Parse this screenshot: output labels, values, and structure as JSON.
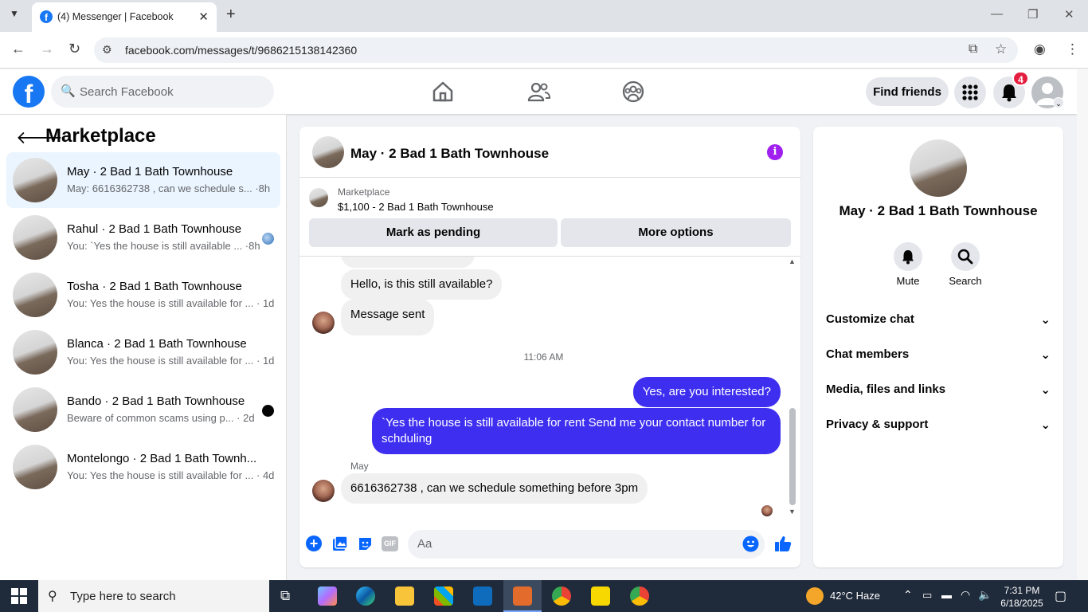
{
  "browser": {
    "tab_title": "(4) Messenger | Facebook",
    "url": "facebook.com/messages/t/9686215138142360"
  },
  "fb_header": {
    "search_placeholder": "Search Facebook",
    "find_friends": "Find friends",
    "notification_count": "4"
  },
  "left_panel": {
    "title": "Marketplace",
    "conversations": [
      {
        "name": "May · 2 Bad 1 Bath Townhouse",
        "preview": "May: 6616362738 , can we schedule s... ·8h",
        "active": true
      },
      {
        "name": "Rahul · 2 Bad 1 Bath Townhouse",
        "preview": "You: `Yes the house is still available ... ·8h"
      },
      {
        "name": "Tosha · 2 Bad 1 Bath Townhouse",
        "preview": "You: Yes the house is still available for ... · 1d"
      },
      {
        "name": "Blanca · 2 Bad 1 Bath Townhouse",
        "preview": "You: Yes the house is still available for ... · 1d"
      },
      {
        "name": "Bando · 2 Bad 1 Bath Townhouse",
        "preview": "Beware of common scams using p... · 2d"
      },
      {
        "name": "Montelongo · 2 Bad 1 Bath Townh...",
        "preview": "You: Yes the house is still available for ... · 4d"
      }
    ]
  },
  "chat": {
    "title": "May · 2 Bad 1 Bath Townhouse",
    "marketplace_label": "Marketplace",
    "listing": "$1,100 - 2 Bad 1 Bath Townhouse",
    "mark_pending": "Mark as pending",
    "more_options": "More options",
    "messages": {
      "m1": "Hello, is this still available?",
      "m2": "Message sent",
      "timestamp": "11:06 AM",
      "m3": "Yes, are you interested?",
      "m4": "`Yes the house is still available for rent Send me your contact number for schduling",
      "sender": "May",
      "m5": "6616362738 , can we schedule something before 3pm"
    },
    "composer_placeholder": "Aa"
  },
  "info_panel": {
    "title": "May · 2 Bad 1 Bath Townhouse",
    "mute": "Mute",
    "search": "Search",
    "rows": [
      "Customize chat",
      "Chat members",
      "Media, files and links",
      "Privacy & support"
    ]
  },
  "taskbar": {
    "search_placeholder": "Type here to search",
    "weather": "42°C  Haze",
    "time": "7:31 PM",
    "date": "6/18/2025"
  }
}
